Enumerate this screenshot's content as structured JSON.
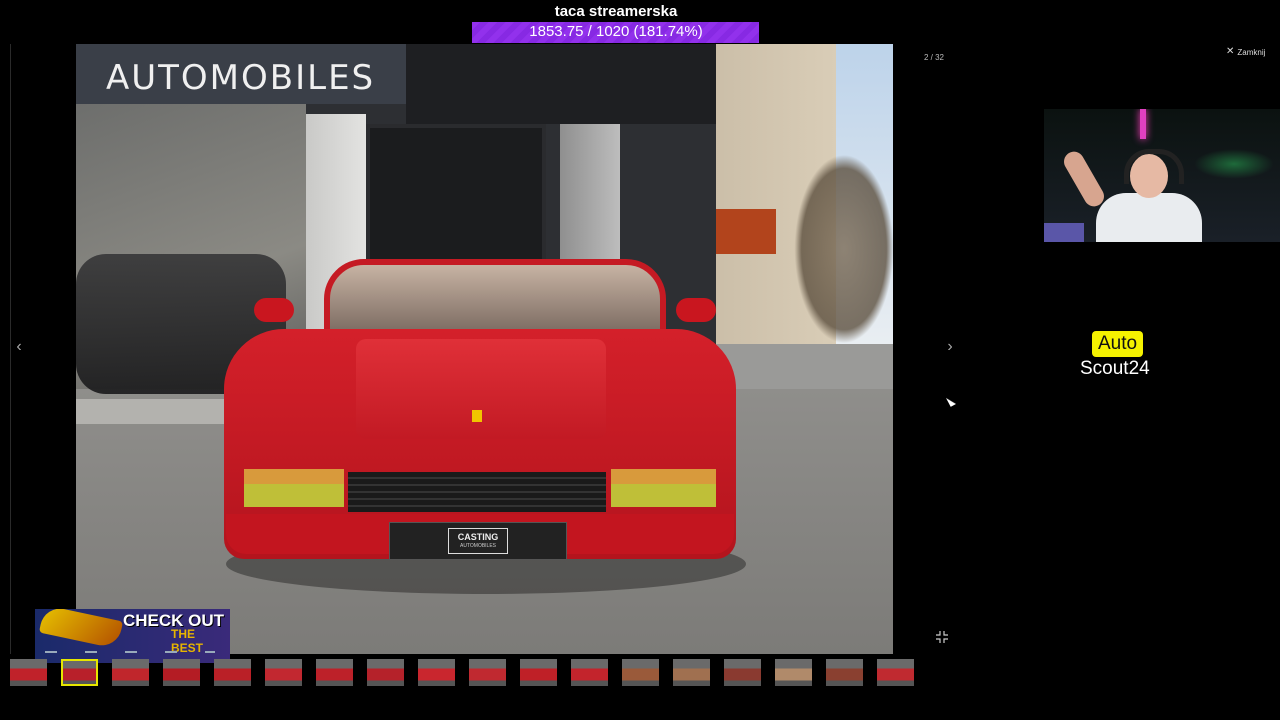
{
  "stream": {
    "goal_title": "taca streamerska",
    "goal_value": "1853.75 / 1020 (181.74%)",
    "goal_fraction": 1.0
  },
  "viewer": {
    "counter": "2 / 32",
    "close_label": "Zamknij",
    "close_icon": "x-icon",
    "prev_icon": "chevron-left-icon",
    "next_icon": "chevron-right-icon",
    "fullscreen_icon": "minimize-icon"
  },
  "photo": {
    "sign_text": "AUTOMOBILES",
    "plate_main": "CASTING",
    "plate_sub": "AUTOMOBILES"
  },
  "promo": {
    "line1": "CHECK OUT",
    "line2": "THE BEST"
  },
  "thumbnails": {
    "count": 18,
    "active_index": 1,
    "colors": [
      "#c0222a",
      "#b8202a",
      "#c0262c",
      "#b41c24",
      "#ba2027",
      "#c22830",
      "#bd2129",
      "#b5222a",
      "#c9262e",
      "#c02930",
      "#bf2027",
      "#c3242c",
      "#9a5a3a",
      "#a07050",
      "#8a3a30",
      "#b08a6a",
      "#8a4030",
      "#c02a30"
    ]
  },
  "logo": {
    "top": "Auto",
    "bottom": "Scout24",
    "accent": "#f5f200"
  }
}
